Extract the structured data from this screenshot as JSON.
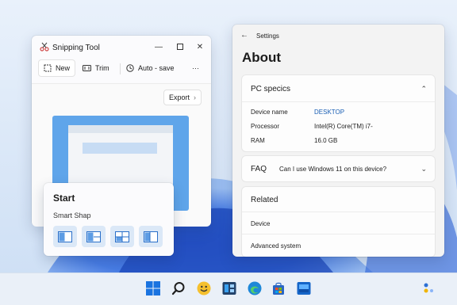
{
  "snipping_tool": {
    "title": "Snipping Tool",
    "toolbar": {
      "new_label": "New",
      "trim_label": "Trim",
      "autosave_label": "Auto - save",
      "more_label": "···"
    },
    "export_label": "Export"
  },
  "snap": {
    "title": "Start",
    "subtitle": "Smart Shap"
  },
  "settings": {
    "breadcrumb": "Settings",
    "page_title": "About",
    "pc_specs": {
      "header": "PC specics",
      "rows": [
        {
          "key": "Device name",
          "value": "DESKTOP"
        },
        {
          "key": "Processor",
          "value": "Intel(R) Core(TM) i7-"
        },
        {
          "key": "RAM",
          "value": "16.0 GB"
        }
      ]
    },
    "faq": {
      "label": "FAQ",
      "question": "Can I use Windows 11 on this device?"
    },
    "related": {
      "header": "Related",
      "items": [
        "Device",
        "Advanced system"
      ]
    }
  },
  "colors": {
    "accent": "#0067c0",
    "link": "#1a5fb4",
    "wallpaper": "#2c5fd6"
  },
  "taskbar": {
    "icons": [
      "windows-start-icon",
      "search-icon",
      "smiley-icon",
      "widgets-icon",
      "edge-icon",
      "store-icon",
      "photos-icon"
    ]
  }
}
